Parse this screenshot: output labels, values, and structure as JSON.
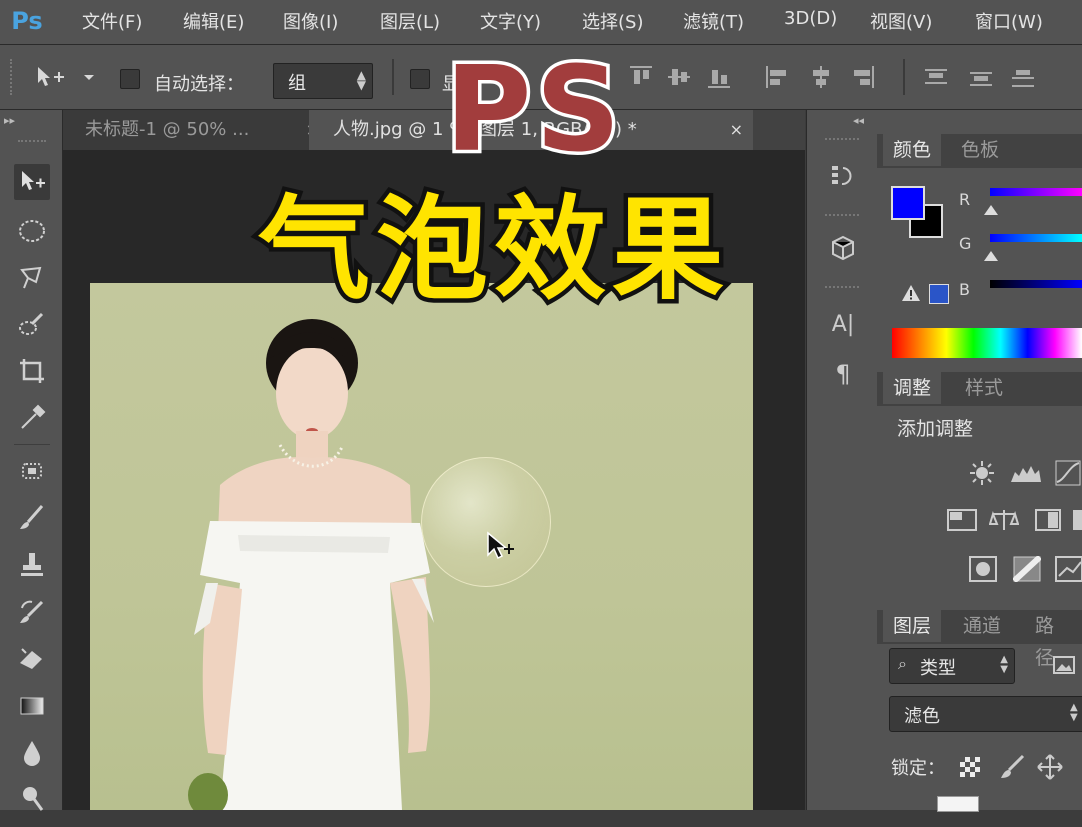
{
  "app": {
    "logo": "Ps"
  },
  "menu": [
    "文件(F)",
    "编辑(E)",
    "图像(I)",
    "图层(L)",
    "文字(Y)",
    "选择(S)",
    "滤镜(T)",
    "3D(D)",
    "视图(V)",
    "窗口(W)"
  ],
  "options": {
    "auto_select_label": "自动选择：",
    "auto_select_value": "组",
    "show_transform_partial": "显"
  },
  "tabs": [
    {
      "label": "未标题-1 @ 50% ...",
      "close": "×",
      "active": false
    },
    {
      "label": "人物.jpg @ 1  % (图层 1, RGB/8#) *",
      "close": "×",
      "active": true
    }
  ],
  "tools": [
    "move-tool",
    "marquee-tool",
    "lasso-tool",
    "quick-select-tool",
    "crop-tool",
    "eyedropper-tool",
    "healing-brush-tool",
    "brush-tool",
    "clone-stamp-tool",
    "history-brush-tool",
    "eraser-tool",
    "gradient-tool",
    "blur-tool",
    "dodge-tool"
  ],
  "color_panel": {
    "tabs": [
      "颜色",
      "色板"
    ],
    "foreground": "#0000ff",
    "background": "#000000",
    "channels": [
      "R",
      "G",
      "B"
    ]
  },
  "adjust_panel": {
    "tabs": [
      "调整",
      "样式"
    ],
    "heading": "添加调整"
  },
  "layers_panel": {
    "tabs": [
      "图层",
      "通道",
      "路径"
    ],
    "filter_kind": "类型",
    "blend_mode": "滤色",
    "lock_label": "锁定："
  },
  "overlay": {
    "title_en": "PS",
    "title_cn": "气泡效果"
  },
  "colors": {
    "accent_red": "#a23d3d",
    "accent_yellow": "#ffe400"
  }
}
